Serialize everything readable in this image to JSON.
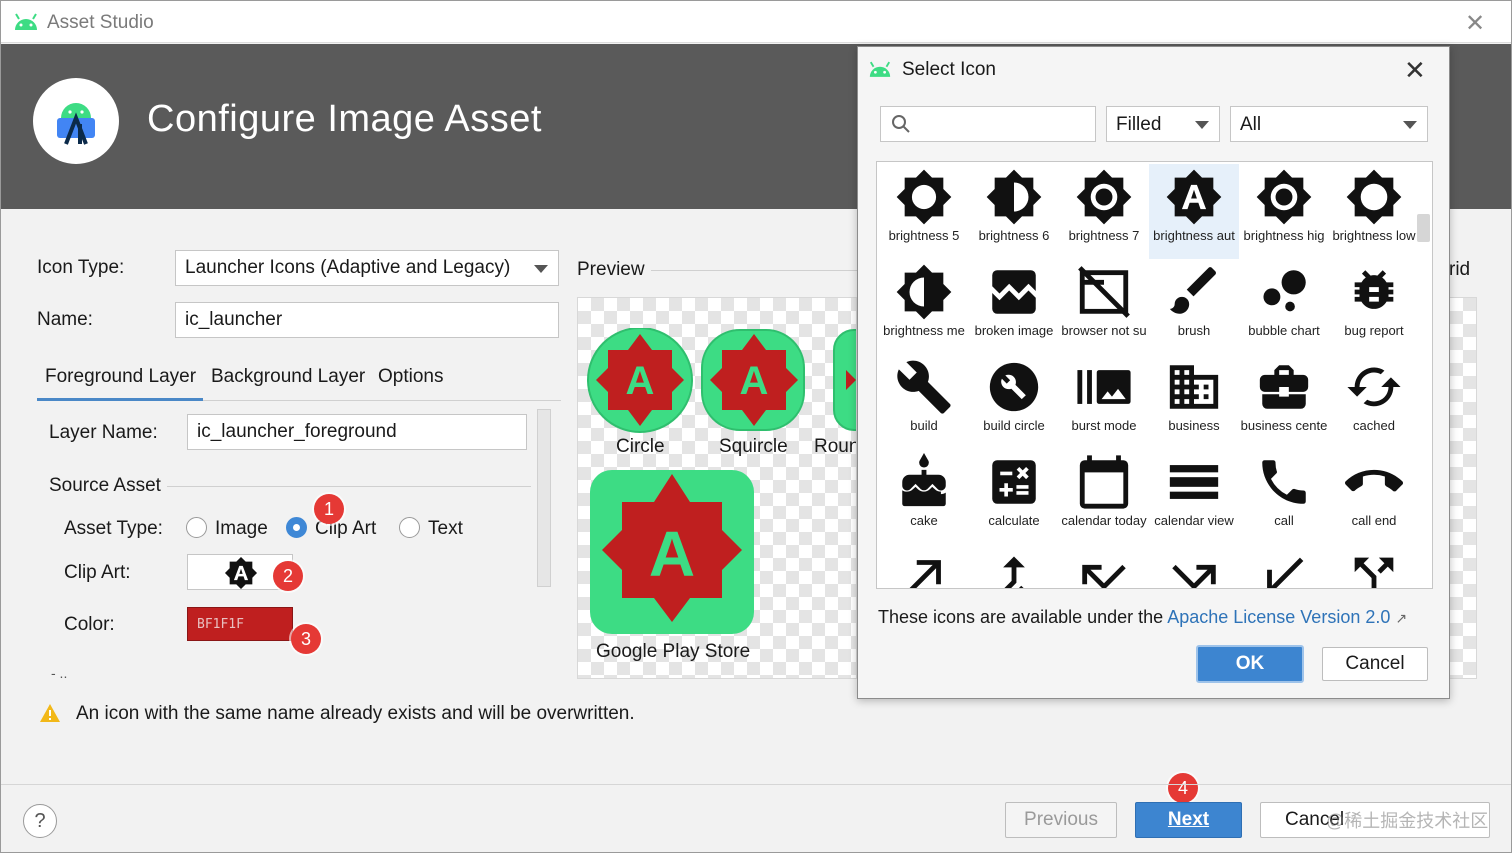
{
  "window": {
    "title": "Asset Studio"
  },
  "header": {
    "title": "Configure Image Asset"
  },
  "form": {
    "icon_type_label": "Icon Type:",
    "icon_type_value": "Launcher Icons (Adaptive and Legacy)",
    "name_label": "Name:",
    "name_value": "ic_launcher",
    "tabs": [
      {
        "label": "Foreground Layer",
        "active": true
      },
      {
        "label": "Background Layer",
        "active": false
      },
      {
        "label": "Options",
        "active": false
      }
    ],
    "layer_name_label": "Layer Name:",
    "layer_name_value": "ic_launcher_foreground",
    "source_asset_label": "Source Asset",
    "asset_type_label": "Asset Type:",
    "asset_type_options": [
      {
        "label": "Image",
        "selected": false
      },
      {
        "label": "Clip Art",
        "selected": true
      },
      {
        "label": "Text",
        "selected": false
      }
    ],
    "clip_art_label": "Clip Art:",
    "color_label": "Color:",
    "color_value": "BF1F1F",
    "color_hex": "#BF1F1F"
  },
  "badges": [
    "1",
    "2",
    "3",
    "4"
  ],
  "preview": {
    "label": "Preview",
    "right_label": "rid",
    "shapes": [
      "Circle",
      "Squircle",
      "Roun",
      "Google Play Store"
    ]
  },
  "warning": {
    "text": "An icon with the same name already exists and will be overwritten."
  },
  "footer": {
    "help_label": "?",
    "previous": "Previous",
    "next": "Next",
    "cancel": "Cancel"
  },
  "watermark": "@稀土掘金技术社区",
  "select_icon_dialog": {
    "title": "Select Icon",
    "search_placeholder": "",
    "style_value": "Filled",
    "category_value": "All",
    "icons": [
      {
        "name": "brightness 5",
        "icon": "brightness-5-icon"
      },
      {
        "name": "brightness 6",
        "icon": "brightness-6-icon"
      },
      {
        "name": "brightness 7",
        "icon": "brightness-7-icon"
      },
      {
        "name": "brightness aut",
        "icon": "brightness-auto-icon",
        "selected": true
      },
      {
        "name": "brightness hig",
        "icon": "brightness-high-icon"
      },
      {
        "name": "brightness low",
        "icon": "brightness-low-icon"
      },
      {
        "name": "brightness me",
        "icon": "brightness-medium-icon"
      },
      {
        "name": "broken image",
        "icon": "broken-image-icon"
      },
      {
        "name": "browser not su",
        "icon": "browser-not-supported-icon"
      },
      {
        "name": "brush",
        "icon": "brush-icon"
      },
      {
        "name": "bubble chart",
        "icon": "bubble-chart-icon"
      },
      {
        "name": "bug report",
        "icon": "bug-report-icon"
      },
      {
        "name": "build",
        "icon": "build-icon"
      },
      {
        "name": "build circle",
        "icon": "build-circle-icon"
      },
      {
        "name": "burst mode",
        "icon": "burst-mode-icon"
      },
      {
        "name": "business",
        "icon": "business-icon"
      },
      {
        "name": "business cente",
        "icon": "business-center-icon"
      },
      {
        "name": "cached",
        "icon": "cached-icon"
      },
      {
        "name": "cake",
        "icon": "cake-icon"
      },
      {
        "name": "calculate",
        "icon": "calculate-icon"
      },
      {
        "name": "calendar today",
        "icon": "calendar-today-icon"
      },
      {
        "name": "calendar view",
        "icon": "calendar-view-icon"
      },
      {
        "name": "call",
        "icon": "call-icon"
      },
      {
        "name": "call end",
        "icon": "call-end-icon"
      },
      {
        "name": "",
        "icon": "call-made-icon"
      },
      {
        "name": "",
        "icon": "call-merge-icon"
      },
      {
        "name": "",
        "icon": "call-missed-icon"
      },
      {
        "name": "",
        "icon": "call-missed-outgoing-icon"
      },
      {
        "name": "",
        "icon": "call-received-icon"
      },
      {
        "name": "",
        "icon": "call-split-icon"
      }
    ],
    "license_prefix": "These icons are available under the",
    "license_link": "Apache License Version 2.0",
    "license_arrow": "↗",
    "ok": "OK",
    "cancel": "Cancel"
  },
  "colors": {
    "accent": "#3d85d0",
    "header_bg": "#5a5a5a",
    "clip_color": "#BF1F1F",
    "preview_green": "#3ddc84"
  }
}
